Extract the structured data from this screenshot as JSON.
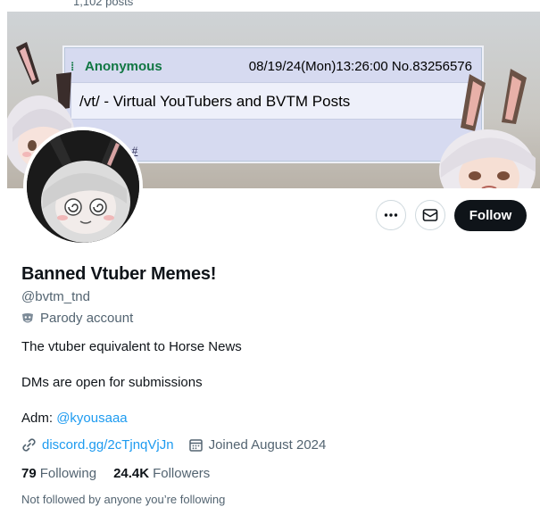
{
  "top_strip": {
    "post_count": "1,102 posts"
  },
  "banner": {
    "post_name": "Anonymous",
    "post_meta": "08/19/24(Mon)13:26:00 No.83256576",
    "board_title": "/vt/ - Virtual YouTubers and BVTM Posts",
    "reply_link": "16 #"
  },
  "actions": {
    "follow_label": "Follow"
  },
  "profile": {
    "display_name": "Banned Vtuber Memes!",
    "handle": "@bvtm_tnd",
    "parody_label": "Parody account",
    "bio_line1": "The vtuber equivalent to Horse News",
    "bio_line2": "DMs are open for submissions",
    "adm_prefix": "Adm: ",
    "adm_mention": "@kyousaaa",
    "website": "discord.gg/2cTjnqVjJn",
    "joined": "Joined August 2024",
    "following_count": "79",
    "following_label": "Following",
    "followers_count": "24.4K",
    "followers_label": "Followers",
    "followed_by": "Not followed by anyone you’re following"
  },
  "colors": {
    "accent": "#1d9bf0",
    "follow_bg": "#0f1419",
    "muted": "#536471",
    "post_name": "#117743"
  }
}
